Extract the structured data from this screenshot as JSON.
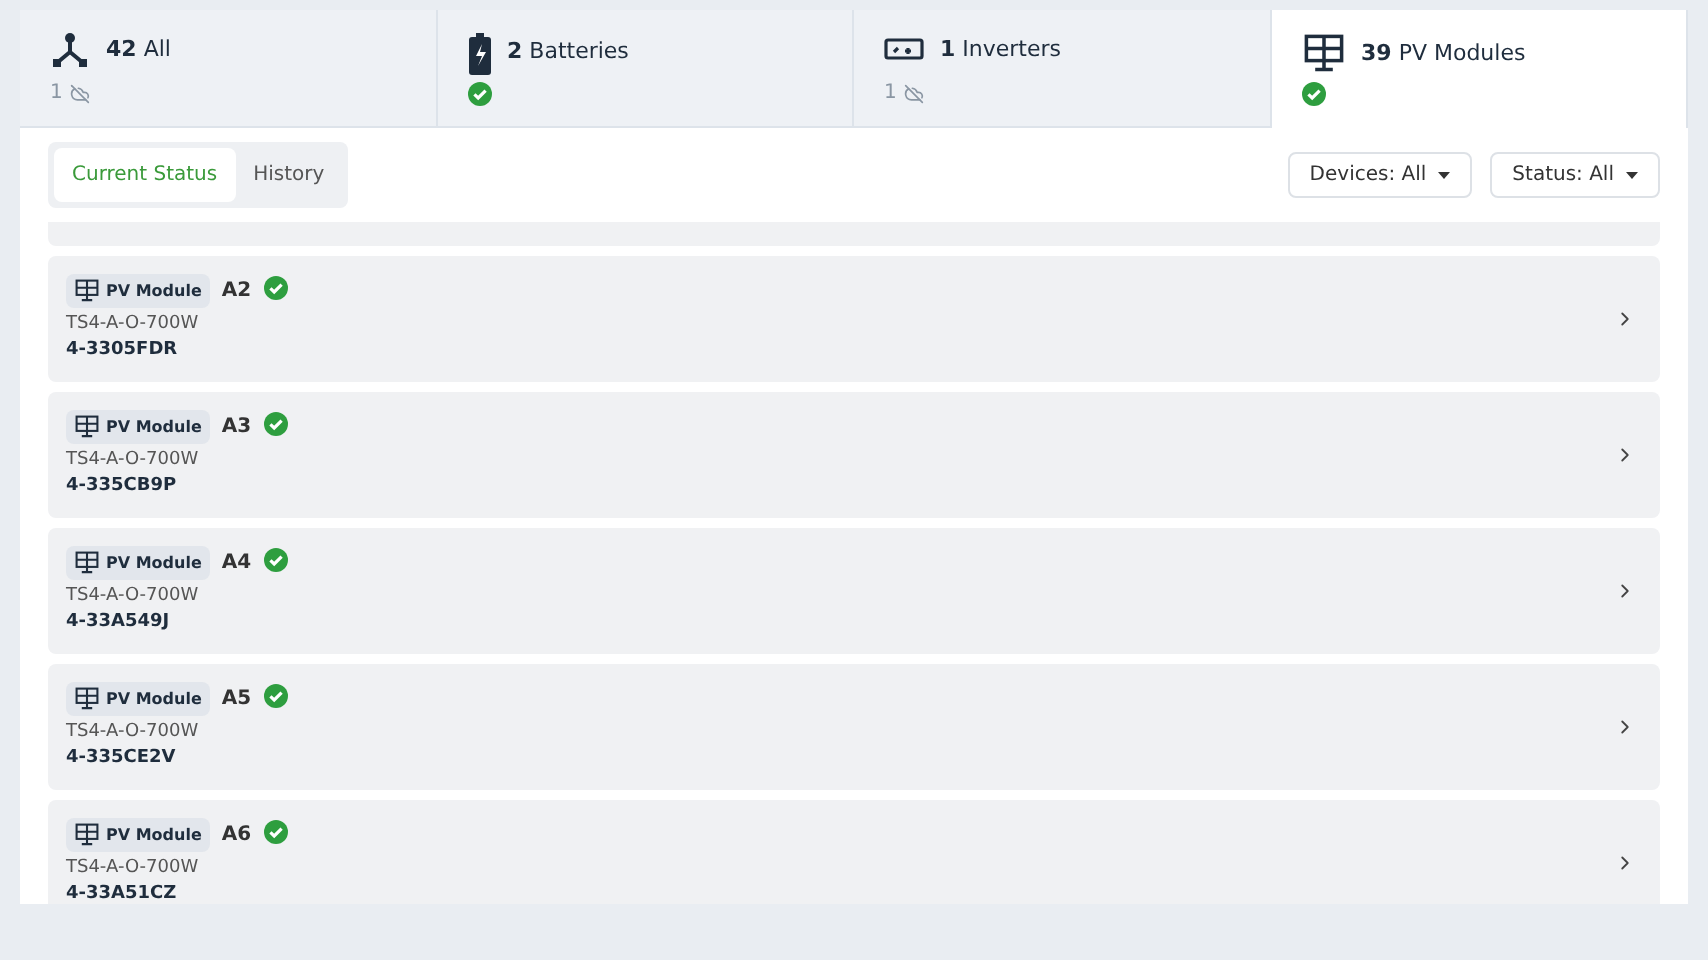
{
  "tabs": [
    {
      "kind": "all",
      "count": "42",
      "label": "All",
      "online": false,
      "offline_count": "1",
      "selected": false
    },
    {
      "kind": "battery",
      "count": "2",
      "label": "Batteries",
      "online": true,
      "selected": false
    },
    {
      "kind": "inverter",
      "count": "1",
      "label": "Inverters",
      "online": false,
      "offline_count": "1",
      "selected": false
    },
    {
      "kind": "pv",
      "count": "39",
      "label": "PV Modules",
      "online": true,
      "selected": true
    }
  ],
  "view_toggle": [
    {
      "label": "Current Status",
      "selected": true
    },
    {
      "label": "History",
      "selected": false
    }
  ],
  "filters": [
    {
      "label": "Devices:",
      "value": "All"
    },
    {
      "label": "Status:",
      "value": "All"
    }
  ],
  "devices": [
    {
      "type": "PV Module",
      "position": "A2",
      "online": true,
      "model": "TS4-A-O-700W",
      "serial": "4-3305FDR"
    },
    {
      "type": "PV Module",
      "position": "A3",
      "online": true,
      "model": "TS4-A-O-700W",
      "serial": "4-335CB9P"
    },
    {
      "type": "PV Module",
      "position": "A4",
      "online": true,
      "model": "TS4-A-O-700W",
      "serial": "4-33A549J"
    },
    {
      "type": "PV Module",
      "position": "A5",
      "online": true,
      "model": "TS4-A-O-700W",
      "serial": "4-335CE2V"
    },
    {
      "type": "PV Module",
      "position": "A6",
      "online": true,
      "model": "TS4-A-O-700W",
      "serial": "4-33A51CZ"
    }
  ]
}
